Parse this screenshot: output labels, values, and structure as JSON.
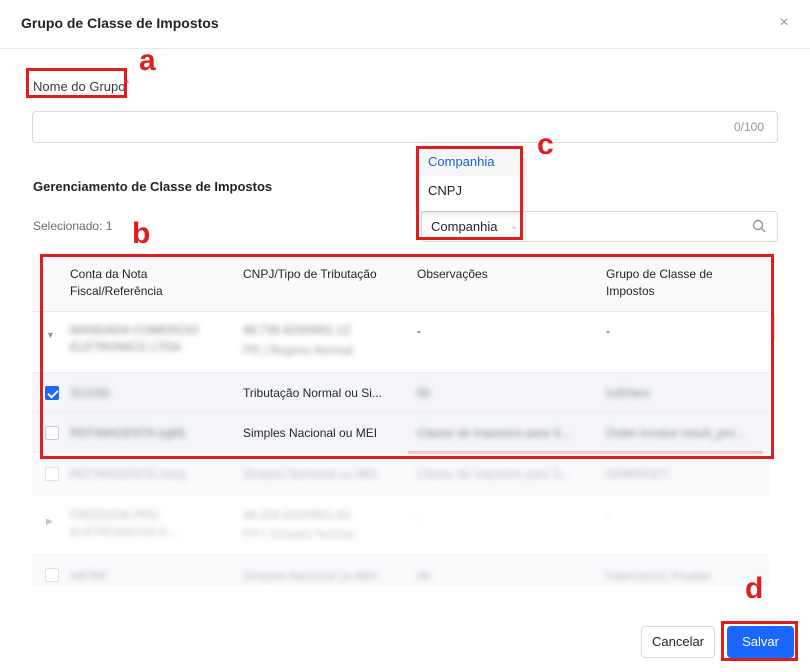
{
  "dialog": {
    "title": "Grupo de Classe de Impostos",
    "close_glyph": "×"
  },
  "form": {
    "name_label": "Nome do Grupo",
    "required_mark": "*",
    "name_value": "",
    "counter": "0/100"
  },
  "section": {
    "title": "Gerenciamento de Classe de Impostos",
    "selected_text": "Selecionado: 1"
  },
  "filter": {
    "selected_option": "Companhia",
    "options": [
      "Companhia",
      "CNPJ"
    ],
    "search_value": ""
  },
  "table": {
    "headers": [
      "Conta da Nota Fiscal/Referência",
      "CNPJ/Tipo de Tributação",
      "Observações",
      "Grupo de Classe de Impostos"
    ],
    "rows": [
      {
        "account": "MANDADA COMERCIO ELETRONICO LTDA",
        "cnpj": "48.730.423/0001-12",
        "cnpj_sub": "PR | Regime Normal",
        "obs": "-",
        "group": "-",
        "checked": false,
        "expandable": true
      },
      {
        "account": "312292",
        "cnpj": "Tributação Normal ou Si...",
        "cnpj_sub": "",
        "obs": "00",
        "group": "IcdVlaro",
        "checked": true,
        "expandable": false
      },
      {
        "account": "REF\\MAGENTA (igM)",
        "cnpj": "Simples Nacional ou MEI",
        "cnpj_sub": "",
        "obs": "Classe de Impostos para S...",
        "group": "Order Invoice result_pro...",
        "checked": false,
        "expandable": false
      },
      {
        "account": "REF\\MAGENTA ctsdy",
        "cnpj": "Simples Nacional ou MEI",
        "cnpj_sub": "",
        "obs": "Classe de Impostos para S...",
        "group": "000MRGKT",
        "checked": false,
        "expandable": false
      },
      {
        "account": "FREEDOM PRO ELETRONICOS E...",
        "cnpj": "46.324.920/0001-63",
        "cnpj_sub": "PR | Simples Normal",
        "obs": "-",
        "group": "-",
        "checked": false,
        "expandable": true
      },
      {
        "account": "AB7MI",
        "cnpj": "Simples Nacional ou MEI",
        "cnpj_sub": "",
        "obs": "00",
        "group": "Fabricación Prueba",
        "checked": false,
        "expandable": false
      }
    ]
  },
  "footer": {
    "cancel_label": "Cancelar",
    "save_label": "Salvar"
  },
  "annotations": {
    "a": "a",
    "b": "b",
    "c": "c",
    "d": "d",
    "color": "#e01e1e"
  },
  "colors": {
    "primary": "#1a66ff",
    "active_option": "#1f5fd6"
  }
}
